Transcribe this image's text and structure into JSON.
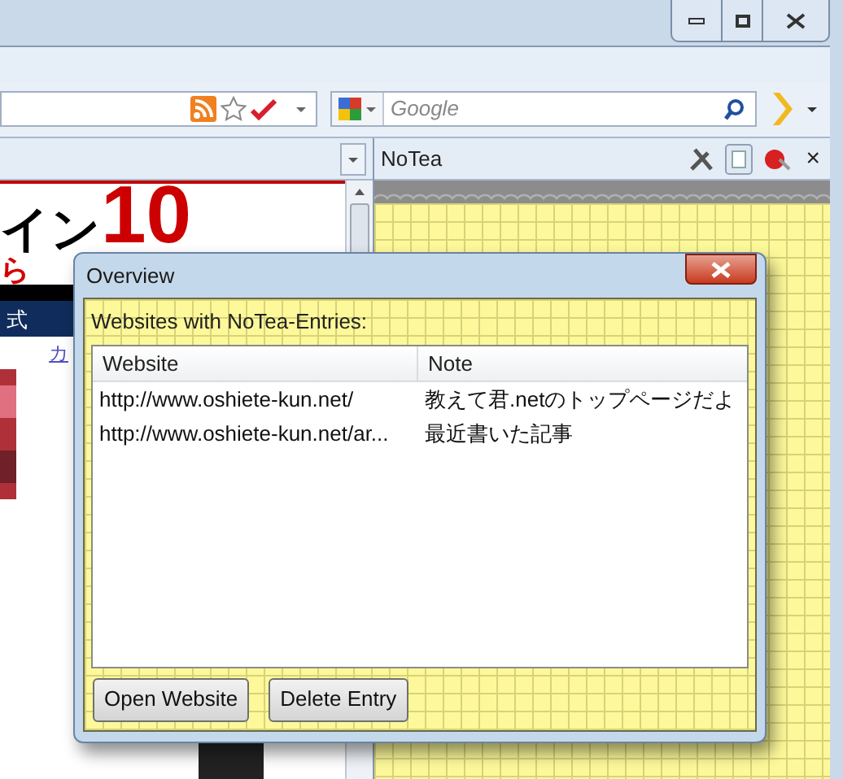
{
  "search": {
    "placeholder": "Google"
  },
  "web_page": {
    "fragments": [
      {
        "kind": "headline",
        "text": "イン"
      },
      {
        "kind": "big",
        "text": "10"
      },
      {
        "kind": "red",
        "text": "ら"
      },
      {
        "kind": "nav",
        "text": "式"
      },
      {
        "kind": "link",
        "text": "カ"
      }
    ]
  },
  "sidebar": {
    "title": "NoTea",
    "close": "×"
  },
  "dialog": {
    "title": "Overview",
    "heading": "Websites with NoTea-Entries:",
    "columns": [
      "Website",
      "Note"
    ],
    "rows": [
      [
        "http://www.oshiete-kun.net/",
        "教えて君.netのトップページだよ"
      ],
      [
        "http://www.oshiete-kun.net/ar...",
        "最近書いた記事"
      ]
    ],
    "buttons": [
      "Open Website",
      "Delete Entry"
    ]
  }
}
